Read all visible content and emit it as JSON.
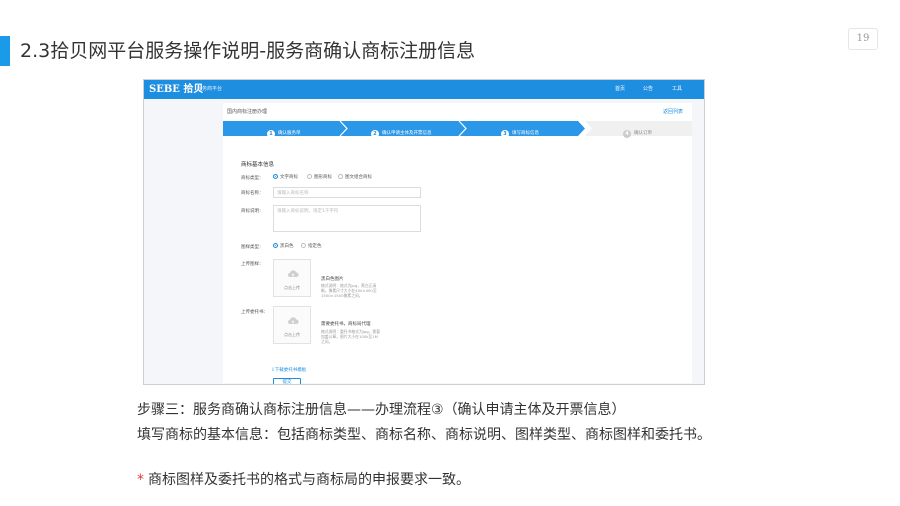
{
  "slide": {
    "title": "2.3拾贝网平台服务操作说明-服务商确认商标注册信息",
    "page_number": "19"
  },
  "app": {
    "logo": "SEBE 拾贝",
    "logo_sub": "服务商平台",
    "nav": [
      "index",
      "公告",
      "工具"
    ],
    "nav_labels": {
      "home": "首页",
      "notice": "公告",
      "tools": "工具"
    },
    "breadcrumb": "国内商标注册办理",
    "back_link": "返回列表",
    "steps": [
      {
        "num": "1",
        "label": "确认服务单"
      },
      {
        "num": "2",
        "label": "确认申请主体及开票信息"
      },
      {
        "num": "3",
        "label": "填写商标信息"
      },
      {
        "num": "4",
        "label": "确认订单"
      }
    ],
    "colors": {
      "header": "#1e8ee0",
      "accent": "#1a9be8",
      "note_star": "#e53935"
    },
    "form": {
      "section_title": "商标基本信息",
      "type_label": "商标类型：",
      "type_options": [
        "文字商标",
        "图形商标",
        "图文组合商标"
      ],
      "name_label": "商标名称：",
      "name_placeholder": "请输入商标名称",
      "desc_label": "商标说明：",
      "desc_placeholder": "请输入商标说明，限定1千字符",
      "color_label": "图样类型：",
      "color_options": [
        "黑白色",
        "指定色"
      ],
      "image_label": "上传图样：",
      "upload_text": "点击上传",
      "image_hint_title": "黑白色图片",
      "image_hint": "格式说明：格式为jpg，黑白正清晰，像素尺寸大小在400×400至1500×1500像素之间。",
      "proxy_label": "上传委托书：",
      "proxy_hint_title": "需要委托书，商标局代理",
      "proxy_hint": "格式说明：委托书格式为jpg，需要加盖公章，图片大小在100k至1M之间。",
      "download_link": "下载委托书模板",
      "submit": "提交"
    }
  },
  "description": {
    "line1": "步骤三：服务商确认商标注册信息——办理流程③（确认申请主体及开票信息）",
    "line2": "填写商标的基本信息：包括商标类型、商标名称、商标说明、图样类型、商标图样和委托书。"
  },
  "note": {
    "star": "*",
    "text": "商标图样及委托书的格式与商标局的申报要求一致。"
  }
}
